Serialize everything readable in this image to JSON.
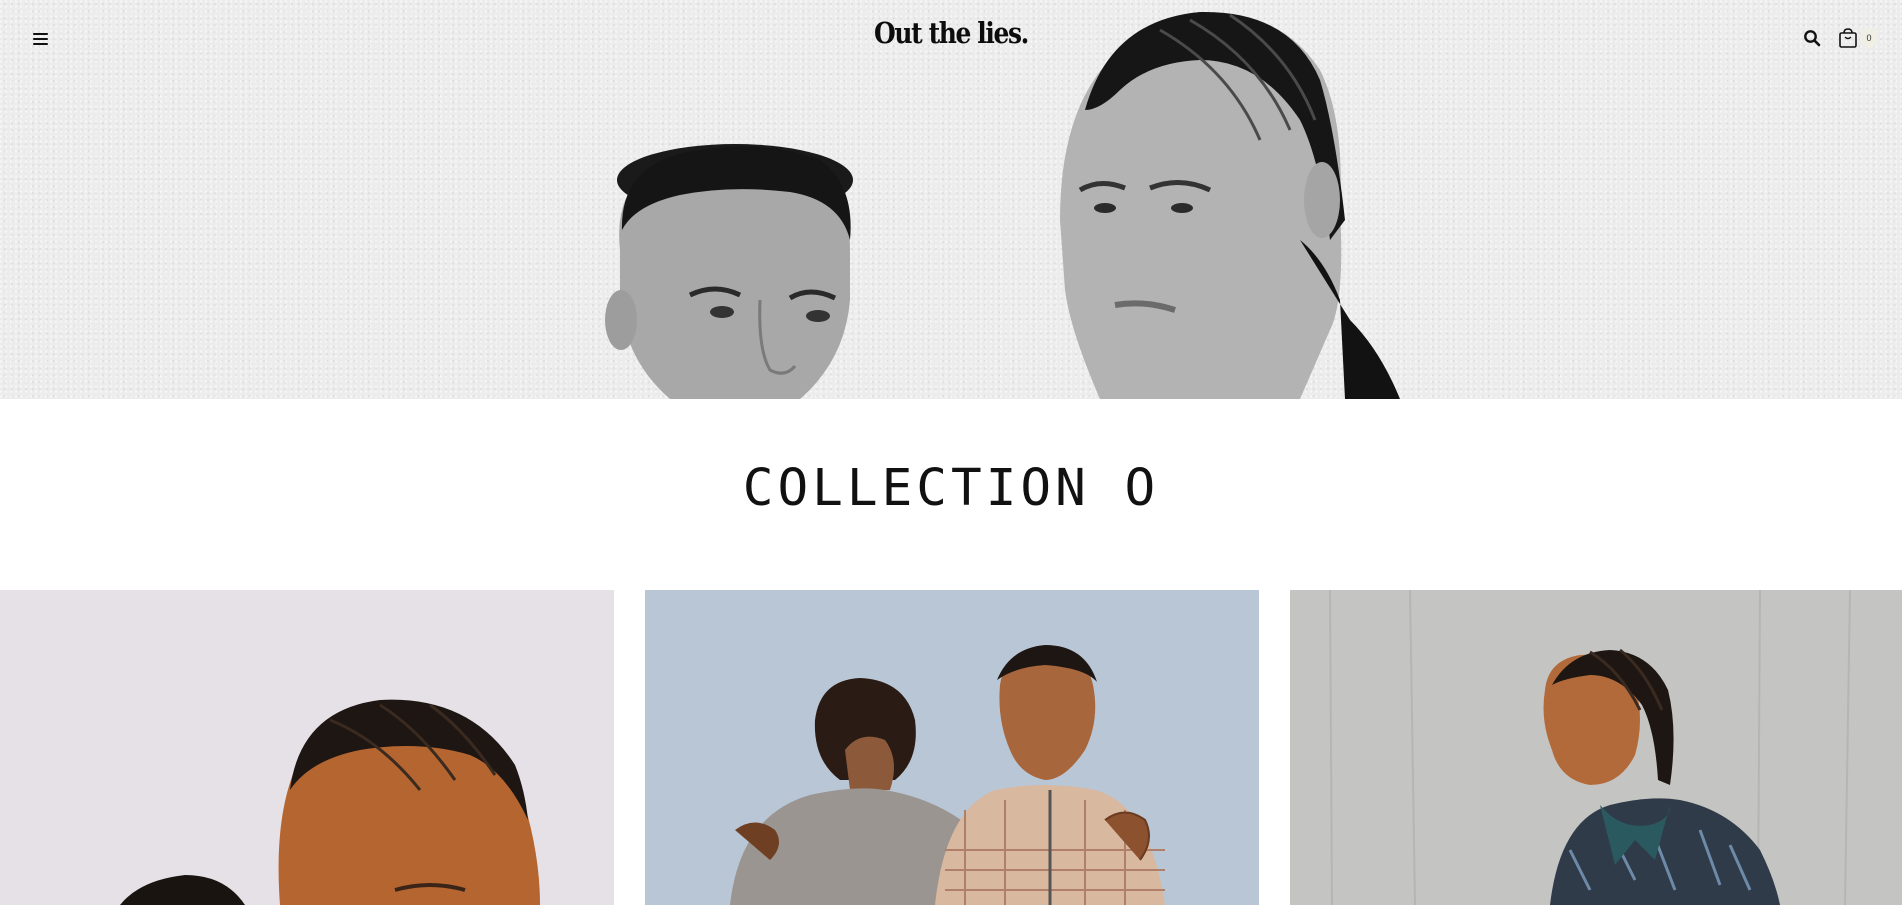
{
  "header": {
    "logo": "Out the lies.",
    "cart_count": "0",
    "icons": {
      "menu": "hamburger-menu-icon",
      "search": "search-icon",
      "cart": "shopping-bag-icon"
    }
  },
  "hero": {
    "image": "hero-photo-two-models-black-and-white"
  },
  "collection": {
    "title": "COLLECTION O",
    "cards": [
      {
        "image": "model-closeup-cornrows-lilac-background"
      },
      {
        "image": "two-models-embracing-blue-background"
      },
      {
        "image": "model-bandana-concrete-background"
      }
    ]
  },
  "colors": {
    "hero_bg": "#ececec",
    "card1_bg": "#e5e1e6",
    "card2_bg": "#b9c6d6",
    "card3_bg": "#c4c4c2",
    "text": "#111111"
  }
}
